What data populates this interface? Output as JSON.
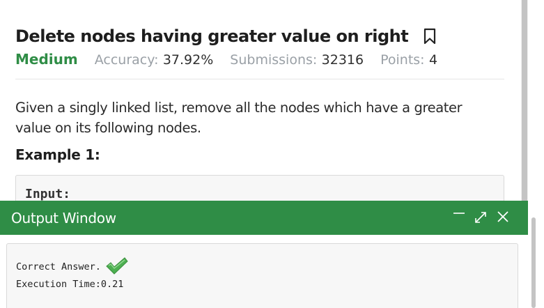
{
  "problem": {
    "title": "Delete nodes having greater value on right",
    "difficulty": "Medium",
    "accuracy_label": "Accuracy:",
    "accuracy_value": "37.92%",
    "submissions_label": "Submissions:",
    "submissions_value": "32316",
    "points_label": "Points:",
    "points_value": "4",
    "description": "Given a singly linked list, remove all the nodes which have a greater value on its following nodes.",
    "example_heading": "Example 1:",
    "example_input_label": "Input:"
  },
  "output_window": {
    "title": "Output Window",
    "result_text": "Correct Answer.",
    "execution_time_text": "Execution Time:0.21"
  },
  "icons": {
    "bookmark": "bookmark-icon",
    "minimize": "minimize-icon",
    "expand": "expand-icon",
    "close": "close-icon",
    "check": "checkmark-icon"
  },
  "colors": {
    "brand_green": "#2f8d46",
    "check_green": "#4caf50",
    "muted_text": "#9aa0a6"
  }
}
